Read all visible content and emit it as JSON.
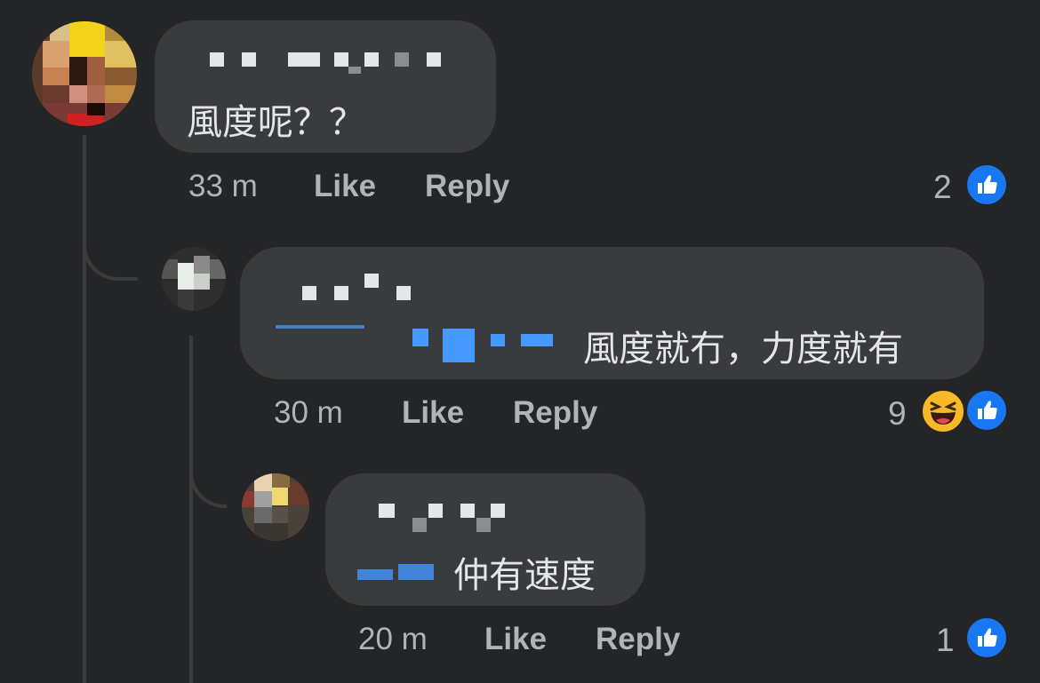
{
  "comments": [
    {
      "text": "風度呢？？",
      "time": "33 m",
      "like_label": "Like",
      "reply_label": "Reply",
      "reaction_count": "2",
      "reactions": [
        "like-icon"
      ]
    },
    {
      "text": "風度就冇，力度就有",
      "time": "30 m",
      "like_label": "Like",
      "reply_label": "Reply",
      "reaction_count": "9",
      "reactions": [
        "haha-icon",
        "like-icon"
      ]
    },
    {
      "text": "仲有速度",
      "time": "20 m",
      "like_label": "Like",
      "reply_label": "Reply",
      "reaction_count": "1",
      "reactions": [
        "like-icon"
      ]
    }
  ],
  "colors": {
    "background": "#242526",
    "bubble": "#3a3b3c",
    "text": "#e4e6eb",
    "meta": "#b0b3b8",
    "mention": "#4599ff",
    "like": "#1877f2",
    "haha": "#f7b928"
  }
}
